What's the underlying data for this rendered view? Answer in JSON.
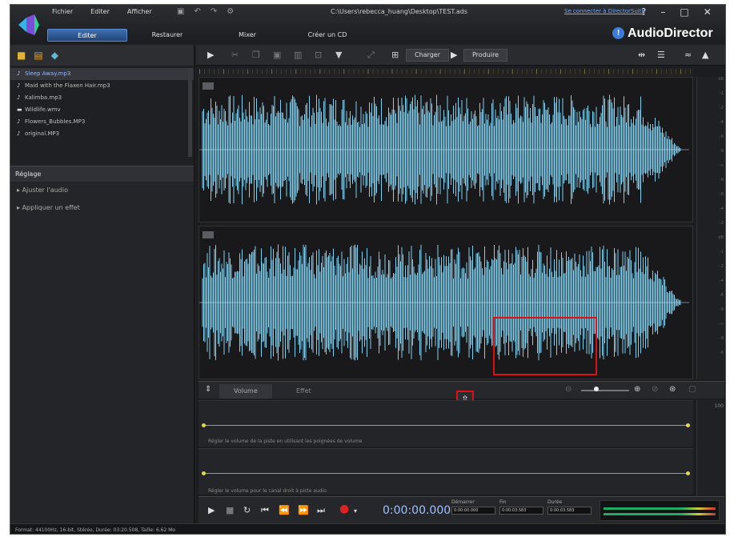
{
  "titlebar": {
    "menus": [
      "Fichier",
      "Editer",
      "Afficher"
    ],
    "file_path": "C:\\Users\\rebecca_huang\\Desktop\\TEST.ads",
    "sign_in": "Se connecter à DirectorSuite",
    "help_glyph": "?",
    "min_glyph": "–",
    "max_glyph": "□",
    "close_glyph": "✕"
  },
  "modes": {
    "tabs": [
      "Editer",
      "Restaurer",
      "Mixer",
      "Créer un CD"
    ],
    "active": "Editer"
  },
  "brand": {
    "name": "AudioDirector"
  },
  "library": {
    "files": [
      {
        "name": "Sleep Away.mp3",
        "icon": "music-note-icon",
        "selected": true
      },
      {
        "name": "Maid with the Flaxen Hair.mp3",
        "icon": "music-note-icon",
        "selected": false
      },
      {
        "name": "Kalimba.mp3",
        "icon": "music-note-icon",
        "selected": false
      },
      {
        "name": "Wildlife.wmv",
        "icon": "video-icon",
        "selected": false
      },
      {
        "name": "Flowers_Bubbles.MP3",
        "icon": "music-note-icon",
        "selected": false
      },
      {
        "name": "original.MP3",
        "icon": "music-note-icon",
        "selected": false
      }
    ]
  },
  "settings": {
    "title": "Réglage",
    "items": [
      "Ajuster l'audio",
      "Appliquer un effet"
    ]
  },
  "editor_toolbar": {
    "load_label": "Charger",
    "produce_label": "Produire"
  },
  "lower_tabs": {
    "tabs": [
      "Volume",
      "Effet"
    ],
    "active": "Volume"
  },
  "lanes": {
    "hint1": "Régler le volume de la piste en utilisant les poignées de volume",
    "hint2": "Régler le volume pour le canal droit à piste audio",
    "scale_value": "100"
  },
  "transport": {
    "timecode": "0:00:00.000",
    "start_label": "Démarrer",
    "start_value": "0:00:00.000",
    "end_label": "Fin",
    "end_value": "0:00:03.583",
    "duration_label": "Durée",
    "duration_value": "0:00:03.583"
  },
  "status": {
    "text": "Format: 44100Hz, 16-bit, Stéréo, Durée: 03:20.508, Taille: 6.62 Mo"
  },
  "colors": {
    "waveform": "#7fd0ee",
    "accent": "#3d7cd8",
    "highlight_box": "#dd1111"
  }
}
